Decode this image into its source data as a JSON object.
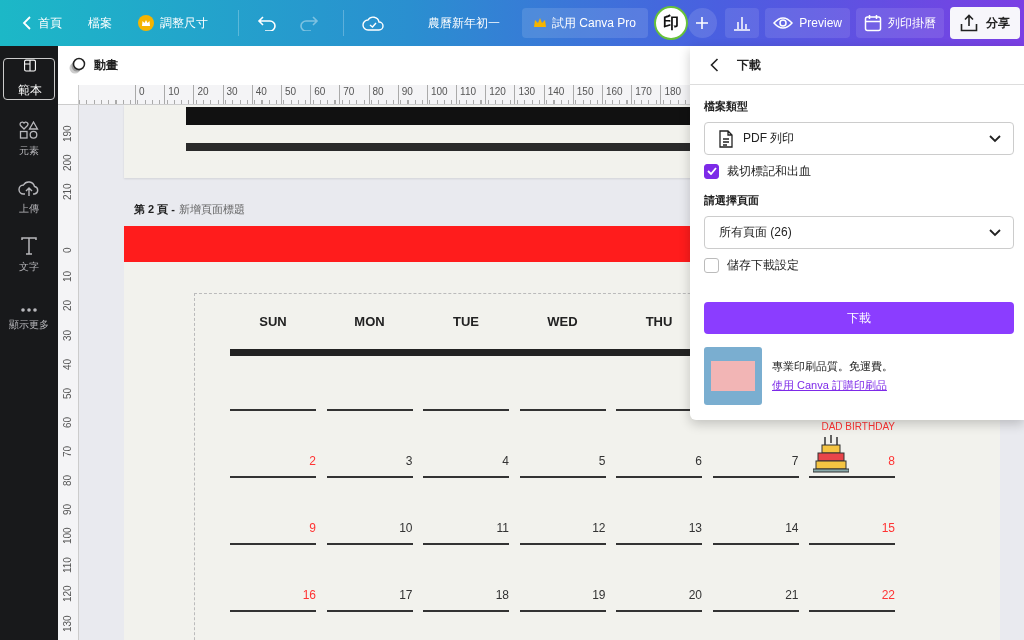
{
  "topbar": {
    "home": "首頁",
    "file": "檔案",
    "resize": "調整尺寸",
    "undo": {
      "disabled": false
    },
    "redo": {
      "disabled": true
    },
    "title": "農曆新年初一",
    "pro": "試用 Canva Pro",
    "avatar": "印",
    "preview": "Preview",
    "print": "列印掛曆",
    "share": "分享"
  },
  "sidebar": {
    "items": [
      {
        "kind": "template",
        "label": "範本",
        "selected": true
      },
      {
        "kind": "elements",
        "label": "元素",
        "selected": false
      },
      {
        "kind": "upload",
        "label": "上傳",
        "selected": false
      },
      {
        "kind": "text",
        "label": "文字",
        "selected": false
      },
      {
        "kind": "more",
        "label": "顯示更多",
        "selected": false
      }
    ]
  },
  "toolbar": {
    "animate": "動畫"
  },
  "ruler": {
    "horizontal": [
      "0",
      "10",
      "20",
      "30",
      "40",
      "50",
      "60",
      "70",
      "80",
      "90",
      "100",
      "110",
      "120",
      "130",
      "140",
      "150",
      "160",
      "170",
      "180"
    ],
    "vertical_page_1": [
      "190",
      "200",
      "210"
    ],
    "vertical_page_2": [
      "0",
      "10",
      "20",
      "30",
      "40",
      "50",
      "60",
      "70",
      "80",
      "90",
      "100",
      "110",
      "120",
      "130"
    ]
  },
  "page_2": {
    "number": "第 2 頁 -",
    "title": "新增頁面標題",
    "calendar": {
      "headers": [
        "SUN",
        "MON",
        "TUE",
        "WED",
        "THU"
      ],
      "weeks": [
        {
          "kind": "blank"
        },
        {
          "kind": "dates",
          "days": [
            {
              "day": "2",
              "color": "#ff3333"
            },
            {
              "day": "3",
              "color": "#333333"
            },
            {
              "day": "4",
              "color": "#333333"
            },
            {
              "day": "5",
              "color": "#333333"
            },
            {
              "day": "6",
              "color": "#333333"
            },
            {
              "day": "7",
              "color": "#333333"
            },
            {
              "day": "8",
              "color": "#ff3333",
              "event": "DAD BIRTHDAY"
            }
          ]
        },
        {
          "kind": "dates",
          "days": [
            {
              "day": "9",
              "color": "#ff3333"
            },
            {
              "day": "10",
              "color": "#333333"
            },
            {
              "day": "11",
              "color": "#333333"
            },
            {
              "day": "12",
              "color": "#333333"
            },
            {
              "day": "13",
              "color": "#333333"
            },
            {
              "day": "14",
              "color": "#333333"
            },
            {
              "day": "15",
              "color": "#ff3333"
            }
          ]
        },
        {
          "kind": "dates",
          "days": [
            {
              "day": "16",
              "color": "#ff3333"
            },
            {
              "day": "17",
              "color": "#333333"
            },
            {
              "day": "18",
              "color": "#333333"
            },
            {
              "day": "19",
              "color": "#333333"
            },
            {
              "day": "20",
              "color": "#333333"
            },
            {
              "day": "21",
              "color": "#333333"
            },
            {
              "day": "22",
              "color": "#ff3333"
            }
          ]
        }
      ]
    }
  },
  "download_panel": {
    "title": "下載",
    "file_type_label": "檔案類型",
    "file_type": "PDF 列印",
    "crop_marks": {
      "label": "裁切標記和出血",
      "checked": true
    },
    "pages_label": "請選擇頁面",
    "pages": "所有頁面 (26)",
    "save_settings": {
      "label": "儲存下載設定",
      "checked": false
    },
    "button": "下載",
    "promo_text": "專業印刷品質。免運費。",
    "promo_link": "使用 Canva 訂購印刷品"
  }
}
